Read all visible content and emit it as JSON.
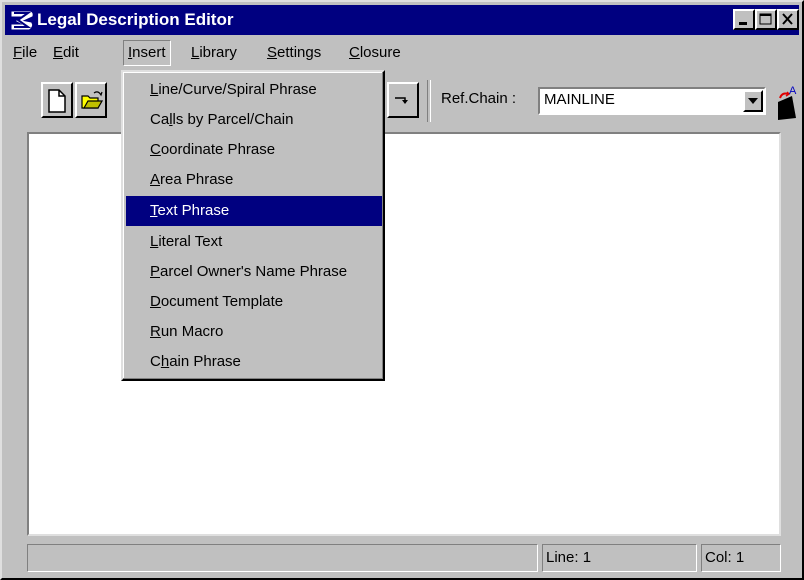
{
  "window": {
    "title": "Legal Description Editor",
    "icon": "app-logo-icon"
  },
  "menubar": {
    "items": [
      {
        "label_u": "F",
        "label_rest": "ile"
      },
      {
        "label_u": "E",
        "label_rest": "dit"
      },
      {
        "label_u": "I",
        "label_rest": "nsert"
      },
      {
        "label_u": "L",
        "label_rest": "ibrary"
      },
      {
        "label_u": "S",
        "label_rest": "ettings"
      },
      {
        "label_u": "C",
        "label_rest": "losure"
      }
    ]
  },
  "toolbar": {
    "ref_chain_label": "Ref.Chain :",
    "ref_chain_value": "MAINLINE"
  },
  "insert_menu": {
    "items": [
      {
        "pre": "",
        "u": "L",
        "post": "ine/Curve/Spiral Phrase"
      },
      {
        "pre": "Ca",
        "u": "l",
        "post": "ls by Parcel/Chain"
      },
      {
        "pre": "",
        "u": "C",
        "post": "oordinate Phrase"
      },
      {
        "pre": "",
        "u": "A",
        "post": "rea Phrase"
      },
      {
        "pre": "",
        "u": "T",
        "post": "ext Phrase"
      },
      {
        "pre": "",
        "u": "L",
        "post": "iteral Text"
      },
      {
        "pre": "",
        "u": "P",
        "post": "arcel Owner's Name Phrase"
      },
      {
        "pre": "",
        "u": "D",
        "post": "ocument Template"
      },
      {
        "pre": "",
        "u": "R",
        "post": "un Macro"
      },
      {
        "pre": "C",
        "u": "h",
        "post": "ain Phrase"
      }
    ],
    "highlighted_index": 4
  },
  "statusbar": {
    "line": "Line: 1",
    "col": "Col: 1"
  },
  "colors": {
    "titlebar": "#000080",
    "face": "#c0c0c0",
    "highlight": "#000080"
  }
}
